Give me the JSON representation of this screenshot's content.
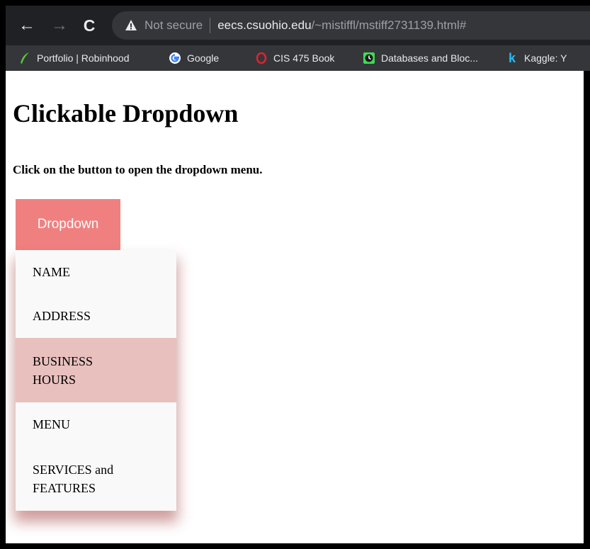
{
  "browser": {
    "security_label": "Not secure",
    "url_host": "eecs.csuohio.edu",
    "url_path": "/~mistiffl/mstiff2731139.html#",
    "bookmarks": [
      {
        "label": "Portfolio | Robinhood",
        "icon": "robinhood-feather-icon"
      },
      {
        "label": "Google",
        "icon": "google-g-icon"
      },
      {
        "label": "CIS 475 Book",
        "icon": "opera-o-icon"
      },
      {
        "label": "Databases and Bloc...",
        "icon": "clock-icon"
      },
      {
        "label": "Kaggle: Y",
        "icon": "kaggle-k-icon"
      }
    ]
  },
  "page": {
    "title": "Clickable Dropdown",
    "subtitle": "Click on the button to open the dropdown menu.",
    "dropdown_button": "Dropdown",
    "menu_items": [
      "NAME",
      "ADDRESS",
      "BUSINESS HOURS",
      "MENU",
      "SERVICES and FEATURES"
    ],
    "hovered_item_index": 2
  },
  "colors": {
    "button_bg": "#f08080",
    "menu_bg": "#f9f9f9",
    "hover_bg": "#e8c0be",
    "toolbar_bg": "#202124",
    "bookmarks_bg": "#35363a"
  }
}
